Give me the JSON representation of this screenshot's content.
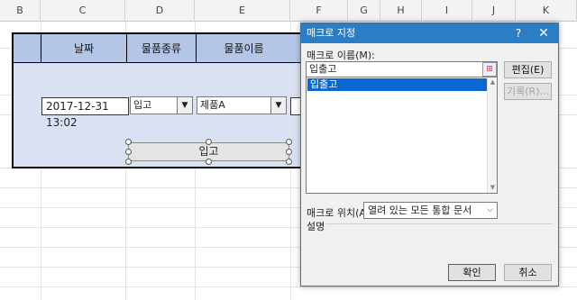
{
  "columns": [
    "B",
    "C",
    "D",
    "E",
    "F",
    "G",
    "H",
    "I",
    "J",
    "K"
  ],
  "table": {
    "headers": [
      "날짜",
      "물품종류",
      "물품이름"
    ],
    "date_value": "2017-12-31 13:02",
    "type_combo": "입고",
    "name_combo": "제품A",
    "button_label": "입고"
  },
  "dialog": {
    "title": "매크로 지정",
    "help": "?",
    "close": "✕",
    "macro_name_label": "매크로 이름(M):",
    "macro_name_value": "입출고",
    "macro_list": [
      "입출고"
    ],
    "edit_button": "편집(E)",
    "record_button": "기록(R)...",
    "location_label": "매크로 위치(A):",
    "location_value": "열려 있는 모든 통합 문서",
    "description_label": "설명",
    "ok_button": "확인",
    "cancel_button": "취소"
  }
}
